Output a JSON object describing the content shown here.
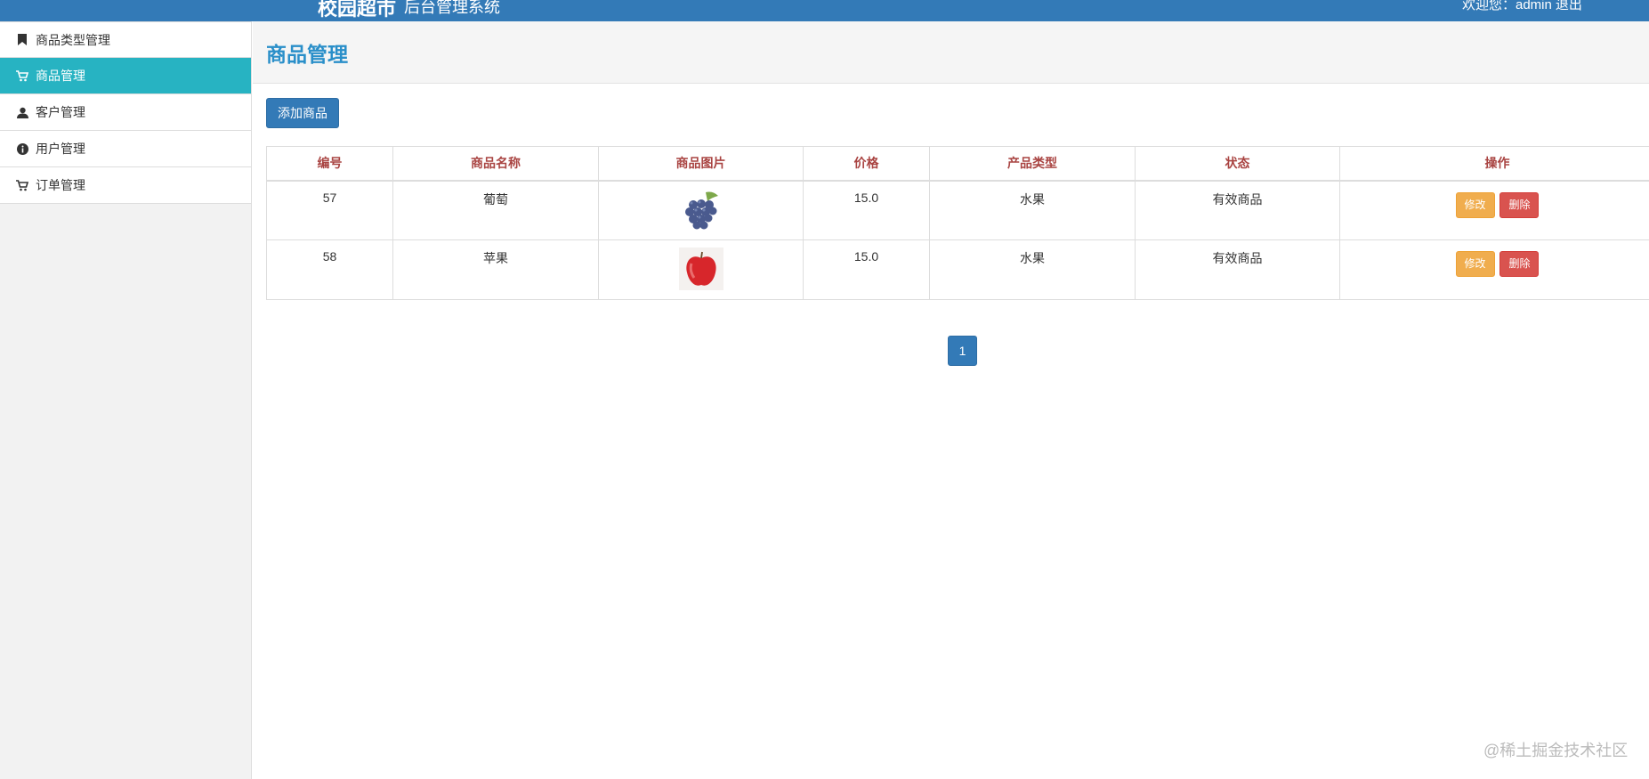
{
  "header": {
    "brand": "校园超市",
    "subtitle": "后台管理系统",
    "welcome": "欢迎您：admin",
    "logout": "退出"
  },
  "sidebar": {
    "items": [
      {
        "label": "商品类型管理",
        "icon": "bookmark-icon",
        "active": false
      },
      {
        "label": "商品管理",
        "icon": "shopping-cart-icon",
        "active": true
      },
      {
        "label": "客户管理",
        "icon": "user-icon",
        "active": false
      },
      {
        "label": "用户管理",
        "icon": "info-circle-icon",
        "active": false
      },
      {
        "label": "订单管理",
        "icon": "shopping-cart-icon",
        "active": false
      }
    ]
  },
  "main": {
    "title": "商品管理",
    "add_button": "添加商品",
    "table": {
      "columns": [
        "编号",
        "商品名称",
        "商品图片",
        "价格",
        "产品类型",
        "状态",
        "操作"
      ],
      "rows": [
        {
          "id": "57",
          "name": "葡萄",
          "image": "grape-image",
          "price": "15.0",
          "type": "水果",
          "status": "有效商品",
          "edit": "修改",
          "delete": "删除"
        },
        {
          "id": "58",
          "name": "苹果",
          "image": "apple-image",
          "price": "15.0",
          "type": "水果",
          "status": "有效商品",
          "edit": "修改",
          "delete": "删除"
        }
      ]
    },
    "pagination": {
      "current": "1"
    }
  },
  "watermark": "@稀土掘金技术社区",
  "colors": {
    "header": "#337ab7",
    "active_menu": "#27b3c2",
    "title": "#2a8fc9",
    "th_text": "#a94442",
    "warning": "#f0ad4e",
    "danger": "#d9534f"
  }
}
